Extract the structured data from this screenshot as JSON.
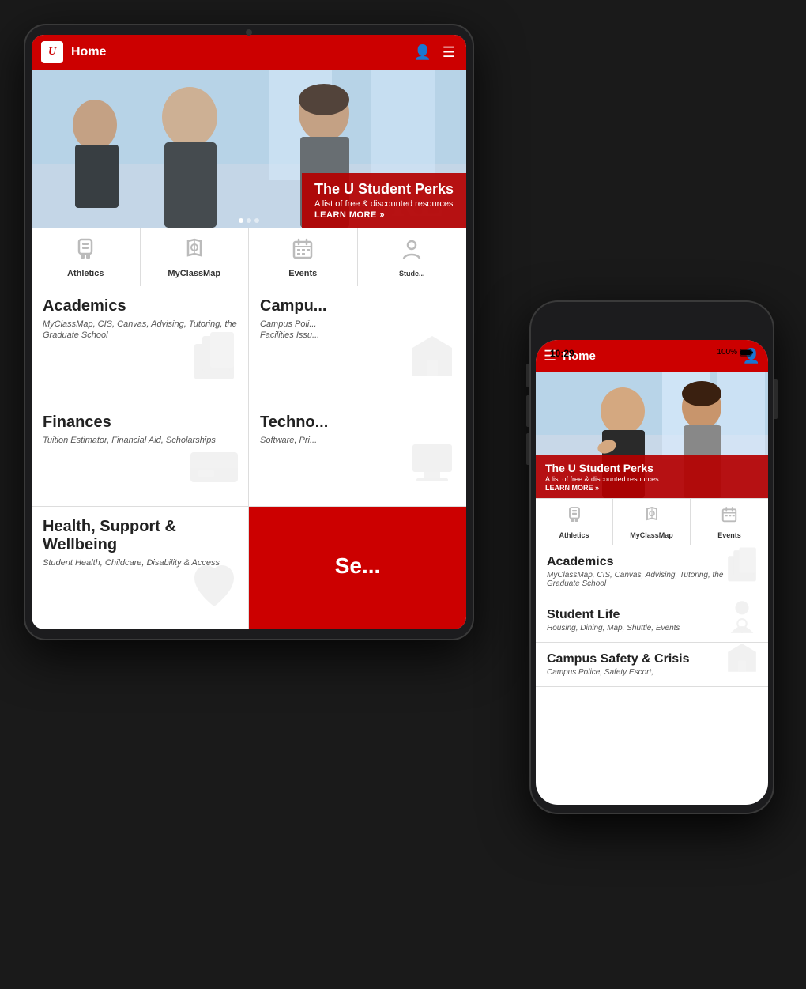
{
  "app": {
    "title": "Home",
    "logo_text": "U"
  },
  "tablet": {
    "hero": {
      "banner_title": "The U Student Perks",
      "banner_sub": "A list of free & discounted resources",
      "banner_link": "LEARN MORE »"
    },
    "quick_links": [
      {
        "label": "Athletics",
        "icon": "🏟"
      },
      {
        "label": "MyClassMap",
        "icon": "🗺"
      },
      {
        "label": "Events",
        "icon": "📅"
      },
      {
        "label": "Student Life",
        "icon": "🎓"
      }
    ],
    "menu_items": [
      {
        "title": "Academics",
        "sub": "MyClassMap, CIS, Canvas, Advising, Tutoring, the Graduate School",
        "bg_icon": "📚"
      },
      {
        "title": "Campus Safety & Crisis",
        "sub": "Campus Police, Safety Escort, Facilities Issues",
        "bg_icon": "🏛"
      },
      {
        "title": "Finances",
        "sub": "Tuition Estimator, Financial Aid, Scholarships",
        "bg_icon": "💳"
      },
      {
        "title": "Technology",
        "sub": "Software, Pri...",
        "bg_icon": "💻"
      },
      {
        "title": "Health, Support & Wellbeing",
        "sub": "Student Health, Childcare, Disability & Access",
        "bg_icon": "❤"
      },
      {
        "title": "Se...",
        "sub": "",
        "is_red": true
      }
    ]
  },
  "phone": {
    "status_time": "10:29",
    "status_battery": "100%",
    "hero": {
      "banner_title": "The U Student Perks",
      "banner_sub": "A list of free & discounted resources",
      "banner_link": "LEARN MORE »"
    },
    "quick_links": [
      {
        "label": "Athletics",
        "icon": "🏟"
      },
      {
        "label": "MyClassMap",
        "icon": "🗺"
      },
      {
        "label": "Events",
        "icon": "📅"
      }
    ],
    "menu_items": [
      {
        "title": "Academics",
        "sub": "MyClassMap, CIS, Canvas, Advising, Tutoring, the Graduate School",
        "bg_icon": "📚"
      },
      {
        "title": "Student Life",
        "sub": "Housing, Dining, Map, Shuttle, Events",
        "bg_icon": "📍"
      },
      {
        "title": "Campus Safety & Crisis",
        "sub": "Campus Police, Safety Escort,",
        "bg_icon": "🏛"
      }
    ]
  }
}
